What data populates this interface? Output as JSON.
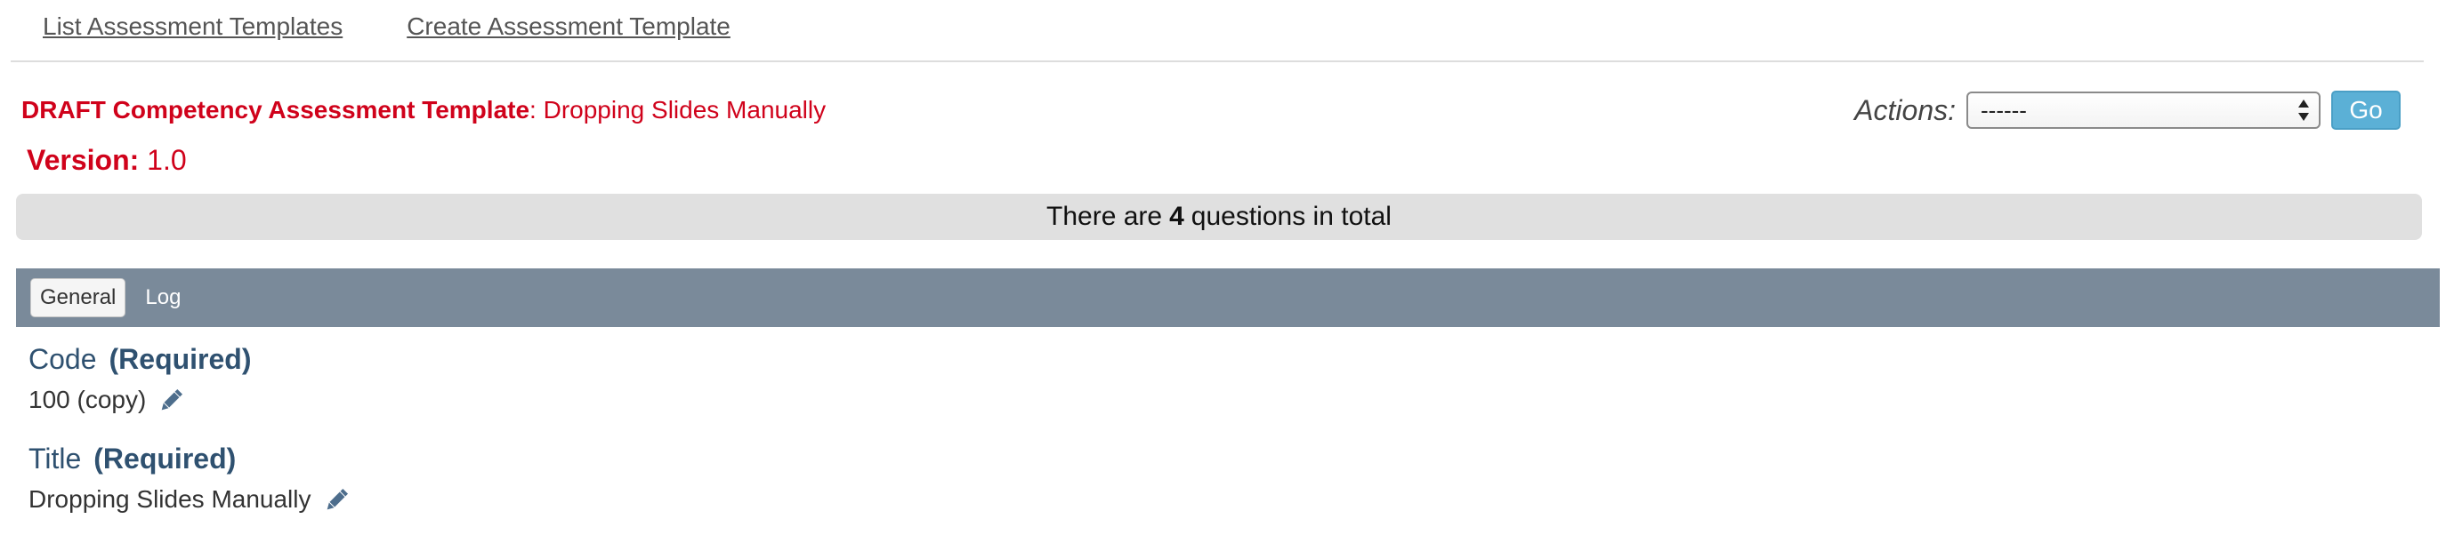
{
  "nav": {
    "list_link": "List Assessment Templates",
    "create_link": "Create Assessment Template"
  },
  "header": {
    "label": "DRAFT Competency Assessment Template",
    "separator": ": ",
    "name": "Dropping Slides Manually",
    "version_label": "Version:",
    "version_value": "1.0"
  },
  "actions": {
    "label": "Actions:",
    "selected": "------",
    "go_label": "Go"
  },
  "banner": {
    "prefix": "There are",
    "count": "4",
    "suffix": "questions in total"
  },
  "tabs": [
    {
      "label": "General",
      "active": true
    },
    {
      "label": "Log",
      "active": false
    }
  ],
  "fields": [
    {
      "label": "Code",
      "required": "(Required)",
      "value": "100 (copy)",
      "icon": "pencil-icon"
    },
    {
      "label": "Title",
      "required": "(Required)",
      "value": "Dropping Slides Manually",
      "icon": "pencil-icon"
    }
  ],
  "colors": {
    "draft_red": "#d0021b",
    "field_title_blue": "#2f5170",
    "tab_bar": "#7a8a9a",
    "go_button": "#5bb0d6",
    "banner_bg": "#e0e0e0"
  }
}
